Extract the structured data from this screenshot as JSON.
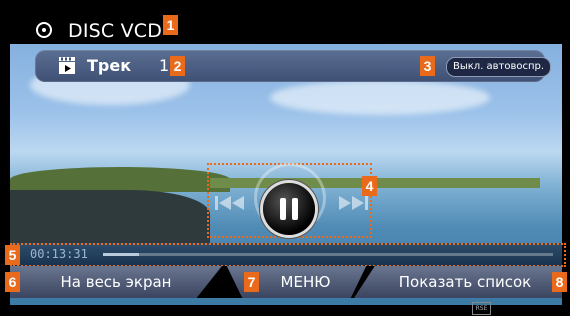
{
  "header": {
    "title": "DISC VCD",
    "icon": "disc-icon"
  },
  "info_bar": {
    "track_icon": "video-track-icon",
    "track_label": "Трек",
    "track_number": "1",
    "autoplay_label": "Выкл. автовоспр."
  },
  "controls": {
    "rewind_icon": "rewind-icon",
    "pause_icon": "pause-icon",
    "fastforward_icon": "fast-forward-icon"
  },
  "progress": {
    "time": "00:13:31",
    "fraction": 0.08
  },
  "bottom": {
    "fullscreen": "На весь экран",
    "menu": "МЕНЮ",
    "show_list": "Показать список"
  },
  "rse_label": "RSE",
  "callouts": [
    "1",
    "2",
    "3",
    "4",
    "5",
    "6",
    "7",
    "8"
  ],
  "colors": {
    "accent": "#e86a1a",
    "bar": "#4a5b7e"
  }
}
